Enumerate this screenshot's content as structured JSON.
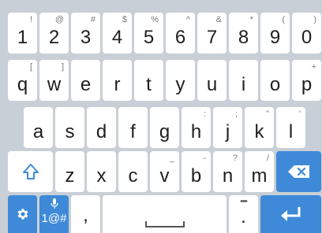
{
  "keyboard": {
    "rows": [
      {
        "keys": [
          {
            "main": "1",
            "alt": "!"
          },
          {
            "main": "2",
            "alt": "@"
          },
          {
            "main": "3",
            "alt": "#"
          },
          {
            "main": "4",
            "alt": "$"
          },
          {
            "main": "5",
            "alt": "%"
          },
          {
            "main": "6",
            "alt": "^"
          },
          {
            "main": "7",
            "alt": "&"
          },
          {
            "main": "8",
            "alt": "*"
          },
          {
            "main": "9",
            "alt": "("
          },
          {
            "main": "0",
            "alt": ")"
          }
        ]
      },
      {
        "keys": [
          {
            "main": "q",
            "alt": "["
          },
          {
            "main": "w",
            "alt": "]"
          },
          {
            "main": "e",
            "alt": ""
          },
          {
            "main": "r",
            "alt": ""
          },
          {
            "main": "t",
            "alt": ""
          },
          {
            "main": "y",
            "alt": ""
          },
          {
            "main": "u",
            "alt": ""
          },
          {
            "main": "i",
            "alt": ""
          },
          {
            "main": "o",
            "alt": ""
          },
          {
            "main": "p",
            "alt": "+"
          }
        ]
      },
      {
        "keys": [
          {
            "main": "a",
            "alt": ""
          },
          {
            "main": "s",
            "alt": ""
          },
          {
            "main": "d",
            "alt": ""
          },
          {
            "main": "f",
            "alt": ""
          },
          {
            "main": "g",
            "alt": ""
          },
          {
            "main": "h",
            "alt": ":"
          },
          {
            "main": "j",
            "alt": ";"
          },
          {
            "main": "k",
            "alt": "\""
          },
          {
            "main": "l",
            "alt": "'"
          }
        ]
      },
      {
        "keys": [
          {
            "main": "z",
            "alt": ""
          },
          {
            "main": "x",
            "alt": ""
          },
          {
            "main": "c",
            "alt": ""
          },
          {
            "main": "v",
            "alt": "_"
          },
          {
            "main": "b",
            "alt": "-"
          },
          {
            "main": "n",
            "alt": "?"
          },
          {
            "main": "m",
            "alt": "/"
          }
        ]
      }
    ],
    "bottom": {
      "settings_icon": "gear-icon",
      "symbols_label": "1@#",
      "mic_icon": "microphone-icon",
      "comma_label": ",",
      "space_icon": "space-bar-icon",
      "period_label": ".",
      "period_alt": "•••",
      "enter_icon": "enter-arrow-icon"
    },
    "shift_icon": "shift-arrow-icon",
    "backspace_icon": "backspace-icon",
    "colors": {
      "accent": "#3e8ad8",
      "background": "#c9cfd6",
      "key": "#ffffff"
    }
  }
}
